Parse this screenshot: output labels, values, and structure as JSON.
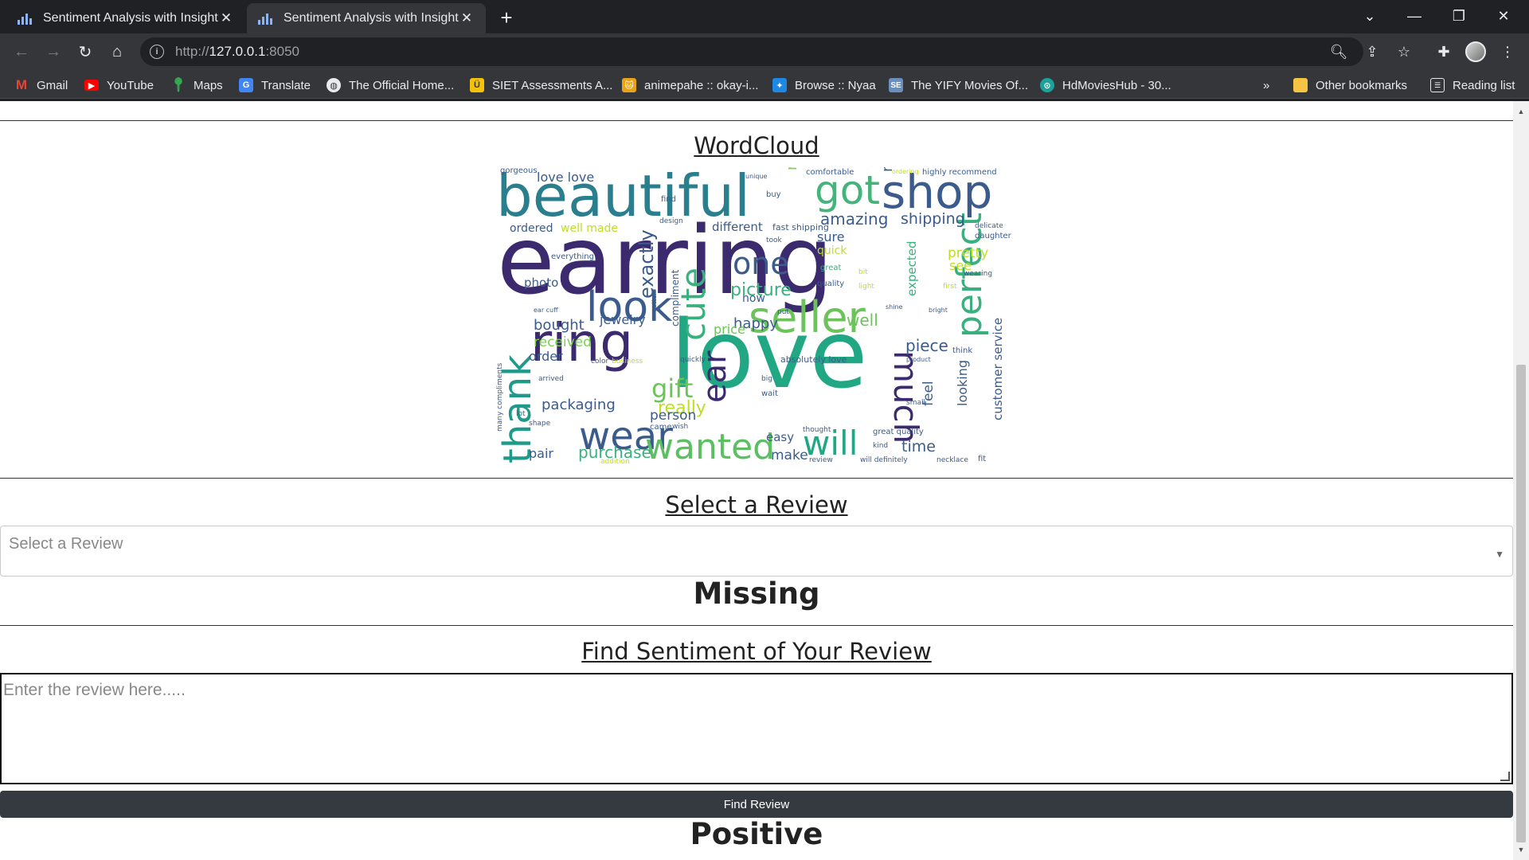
{
  "browser": {
    "tabs": [
      {
        "title": "Sentiment Analysis with Insights",
        "active": false
      },
      {
        "title": "Sentiment Analysis with Insights",
        "active": true
      }
    ],
    "url_host": "127.0.0.1",
    "url_prefix": "http://",
    "url_port": ":8050",
    "bookmarks": [
      {
        "label": "Gmail",
        "icon": "gmail-icon",
        "color": "#ea4335"
      },
      {
        "label": "YouTube",
        "icon": "youtube-icon",
        "color": "#ff0000"
      },
      {
        "label": "Maps",
        "icon": "maps-icon",
        "color": "#34a853"
      },
      {
        "label": "Translate",
        "icon": "translate-icon",
        "color": "#4285f4"
      },
      {
        "label": "The Official Home...",
        "icon": "globe-icon",
        "color": "#bdc1c6"
      },
      {
        "label": "SIET Assessments A...",
        "icon": "siet-icon",
        "color": "#f4c20d"
      },
      {
        "label": "animepahe :: okay-i...",
        "icon": "animepahe-icon",
        "color": "#e8a317"
      },
      {
        "label": "Browse :: Nyaa",
        "icon": "nyaa-icon",
        "color": "#1e88e5"
      },
      {
        "label": "The YIFY Movies Of...",
        "icon": "yify-icon",
        "color": "#6c8ebf"
      },
      {
        "label": "HdMoviesHub - 30...",
        "icon": "hdmovieshub-icon",
        "color": "#1aa39a"
      }
    ],
    "more_bookmarks": "»",
    "other_bookmarks": "Other bookmarks",
    "reading_list": "Reading list"
  },
  "page": {
    "wordcloud_title": "WordCloud",
    "select_review_title": "Select a Review",
    "select_placeholder": "Select a Review",
    "select_result": "Missing",
    "find_title": "Find Sentiment of Your Review",
    "textarea_placeholder": "Enter the review here.....",
    "find_button": "Find Review",
    "find_result": "Positive"
  },
  "wordcloud": {
    "words": [
      "earring",
      "beautiful",
      "love",
      "ring",
      "look",
      "seller",
      "shop",
      "got",
      "wear",
      "wanted",
      "will",
      "much",
      "perfect",
      "thank",
      "cute",
      "one",
      "gift",
      "picture",
      "exactly",
      "ear",
      "piece",
      "bought",
      "received",
      "packaging",
      "really",
      "pretty",
      "amazing",
      "shipping",
      "made",
      "nice",
      "well",
      "happy",
      "jewelry",
      "price",
      "order",
      "person",
      "pair",
      "purchase",
      "make",
      "time",
      "feel",
      "looking",
      "customer service",
      "expected",
      "sure",
      "quick",
      "see",
      "photo",
      "love love",
      "ordered",
      "well made",
      "different",
      "fast shipping",
      "compliment",
      "now",
      "easy",
      "everything",
      "gorgeous",
      "comfortable",
      "highly recommend",
      "ordering",
      "daughter",
      "delicate",
      "quality",
      "great",
      "buy",
      "find",
      "design",
      "took",
      "bit",
      "light",
      "wearing",
      "first",
      "think",
      "absolutely love",
      "many compliments",
      "arrived",
      "shape",
      "color",
      "came",
      "wish",
      "big",
      "wait",
      "thought",
      "great quality",
      "kind",
      "small",
      "will definitely",
      "fit",
      "necklace",
      "review",
      "addition",
      "lot",
      "ear cuff",
      "product",
      "shine",
      "bright",
      "put",
      "gotten",
      "quickly",
      "unique",
      "business"
    ]
  }
}
